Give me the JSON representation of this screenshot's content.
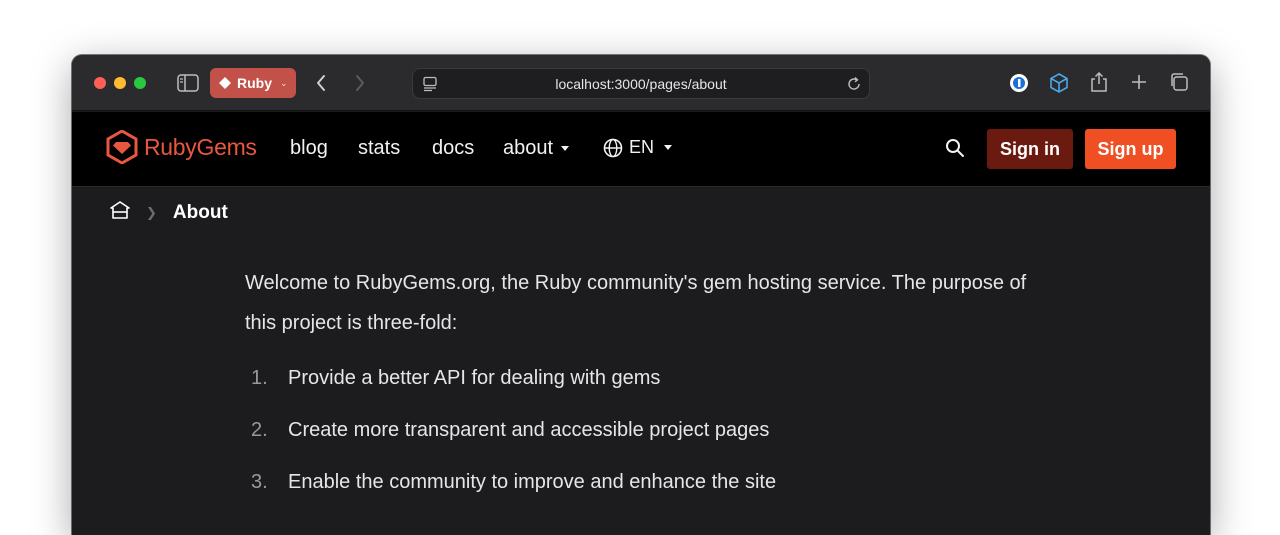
{
  "browser": {
    "tab_group_label": "Ruby",
    "url": "localhost:3000/pages/about"
  },
  "header": {
    "logo_text": "RubyGems",
    "nav": {
      "blog": "blog",
      "stats": "stats",
      "docs": "docs",
      "about": "about"
    },
    "language": "EN",
    "sign_in": "Sign in",
    "sign_up": "Sign up"
  },
  "breadcrumb": {
    "current": "About"
  },
  "main": {
    "intro": "Welcome to RubyGems.org, the Ruby community's gem hosting service. The purpose of this project is three-fold:",
    "list": [
      {
        "num": "1.",
        "text": "Provide a better API for dealing with gems"
      },
      {
        "num": "2.",
        "text": "Create more transparent and accessible project pages"
      },
      {
        "num": "3.",
        "text": "Enable the community to improve and enhance the site"
      }
    ]
  },
  "colors": {
    "brand": "#e9573f",
    "sign_in_bg": "#6b1a10",
    "sign_up_bg": "#f04f23",
    "tab_group_bg": "#c2514a"
  }
}
